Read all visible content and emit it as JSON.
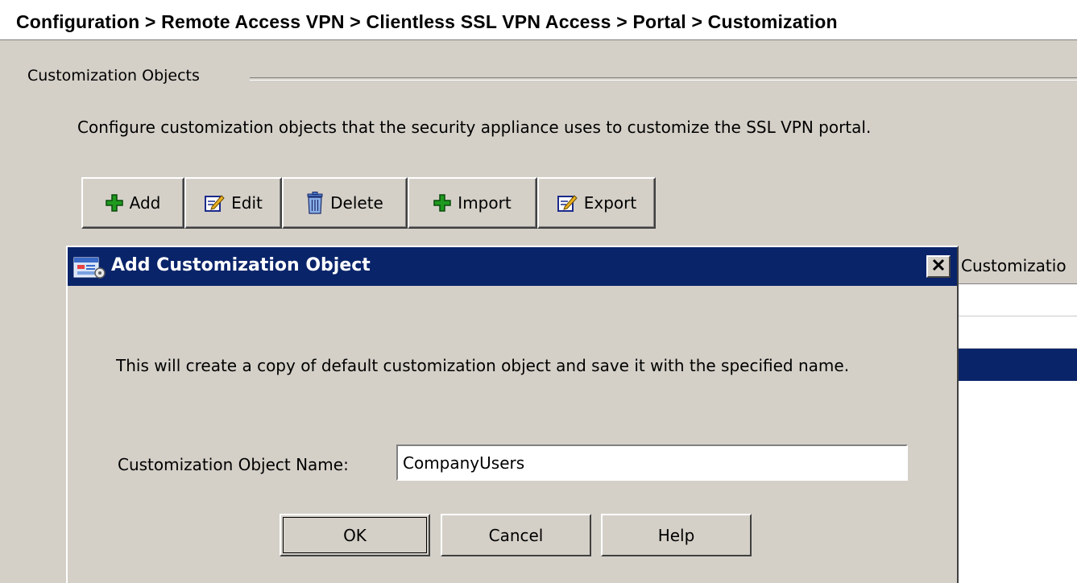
{
  "breadcrumb": "Configuration > Remote Access VPN > Clientless SSL VPN Access > Portal > Customization",
  "group": {
    "title": "Customization Objects",
    "description": "Configure customization objects that the security appliance uses to customize the SSL VPN portal."
  },
  "toolbar": {
    "add_label": "Add",
    "edit_label": "Edit",
    "delete_label": "Delete",
    "import_label": "Import",
    "export_label": "Export",
    "icons": [
      "plus-icon",
      "edit-icon",
      "trash-icon",
      "plus-icon",
      "edit-icon"
    ]
  },
  "background_list": {
    "column_header": "Customizatio"
  },
  "dialog": {
    "title": "Add Customization Object",
    "message": "This will create a copy of default customization object and save it with the specified name.",
    "name_label": "Customization Object Name:",
    "name_value": "CompanyUsers",
    "ok_label": "OK",
    "cancel_label": "Cancel",
    "help_label": "Help"
  },
  "colors": {
    "titlebar": "#0a246a",
    "face": "#d4d0c8",
    "selection": "#0a246a",
    "icon_green": "#1e9a1e"
  }
}
